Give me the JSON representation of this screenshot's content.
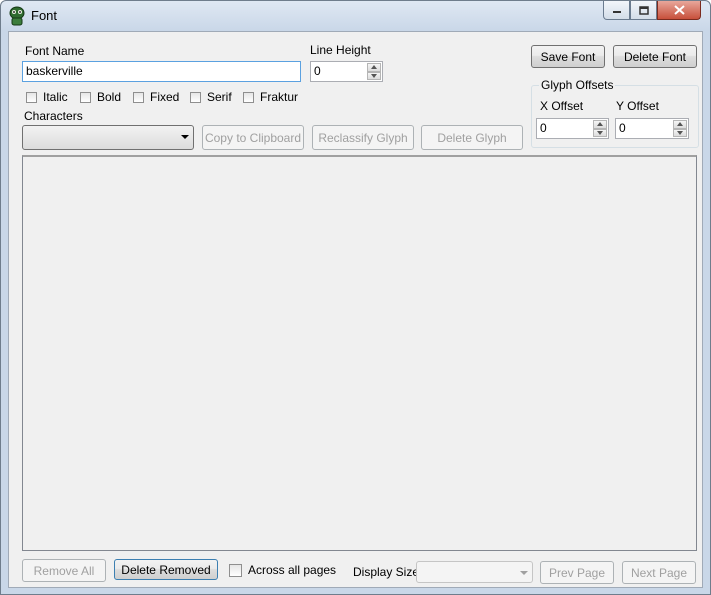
{
  "window": {
    "title": "Font",
    "app_icon": "frog-icon"
  },
  "font_name": {
    "label": "Font Name",
    "value": "baskerville"
  },
  "line_height": {
    "label": "Line Height",
    "value": "0"
  },
  "buttons": {
    "save_font": "Save Font",
    "delete_font": "Delete Font",
    "copy_clipboard": "Copy to Clipboard",
    "reclassify": "Reclassify Glyph",
    "delete_glyph": "Delete Glyph",
    "remove_all": "Remove All",
    "delete_removed": "Delete Removed",
    "prev_page": "Prev Page",
    "next_page": "Next Page"
  },
  "styles": [
    {
      "label": "Italic",
      "checked": false
    },
    {
      "label": "Bold",
      "checked": false
    },
    {
      "label": "Fixed",
      "checked": false
    },
    {
      "label": "Serif",
      "checked": false
    },
    {
      "label": "Fraktur",
      "checked": false
    }
  ],
  "characters": {
    "label": "Characters",
    "value": ""
  },
  "glyph_offsets": {
    "title": "Glyph Offsets",
    "x_label": "X Offset",
    "x_value": "0",
    "y_label": "Y Offset",
    "y_value": "0"
  },
  "footer": {
    "across_all_pages": "Across all pages",
    "display_size_label": "Display Size",
    "display_size_value": ""
  },
  "colors": {
    "close_button": "#c7503b",
    "client_bg": "#f0f0f0",
    "focus_border": "#5ba1e0"
  }
}
